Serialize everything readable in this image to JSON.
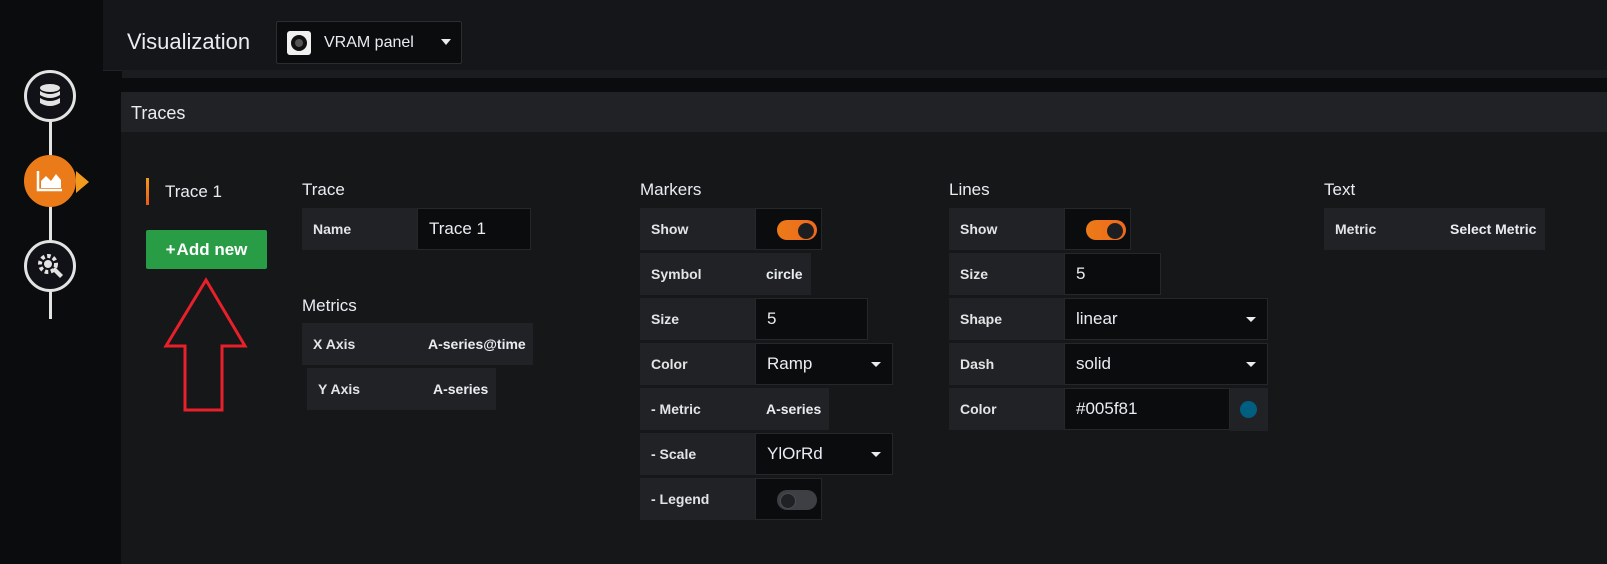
{
  "header": {
    "title": "Visualization",
    "panel_type": "VRAM panel"
  },
  "wizard": {
    "steps": [
      "database-icon",
      "chart-area-icon",
      "cog-wrench-icon"
    ],
    "active_index": 1
  },
  "traces": {
    "title": "Traces",
    "tab_label": "Trace 1",
    "add_new_label": "Add new",
    "trace_section": {
      "title": "Trace",
      "name_label": "Name",
      "name_value": "Trace 1"
    },
    "metrics_section": {
      "title": "Metrics",
      "x_axis_label": "X Axis",
      "x_axis_value": "A-series@time",
      "y_axis_label": "Y Axis",
      "y_axis_value": "A-series"
    },
    "markers_section": {
      "title": "Markers",
      "show_label": "Show",
      "show_on": true,
      "symbol_label": "Symbol",
      "symbol_value": "circle",
      "size_label": "Size",
      "size_value": "5",
      "color_label": "Color",
      "color_value": "Ramp",
      "metric_label": "- Metric",
      "metric_value": "A-series",
      "scale_label": "- Scale",
      "scale_value": "YlOrRd",
      "legend_label": "- Legend",
      "legend_on": false
    },
    "lines_section": {
      "title": "Lines",
      "show_label": "Show",
      "show_on": true,
      "size_label": "Size",
      "size_value": "5",
      "shape_label": "Shape",
      "shape_value": "linear",
      "dash_label": "Dash",
      "dash_value": "solid",
      "color_label": "Color",
      "color_value": "#005f81"
    },
    "text_section": {
      "title": "Text",
      "metric_label": "Metric",
      "metric_value": "Select Metric"
    }
  },
  "colors": {
    "accent": "#eb7b18",
    "add_button": "#299c46",
    "annotation_arrow": "#e8202a",
    "line_color_swatch": "#005f81"
  }
}
